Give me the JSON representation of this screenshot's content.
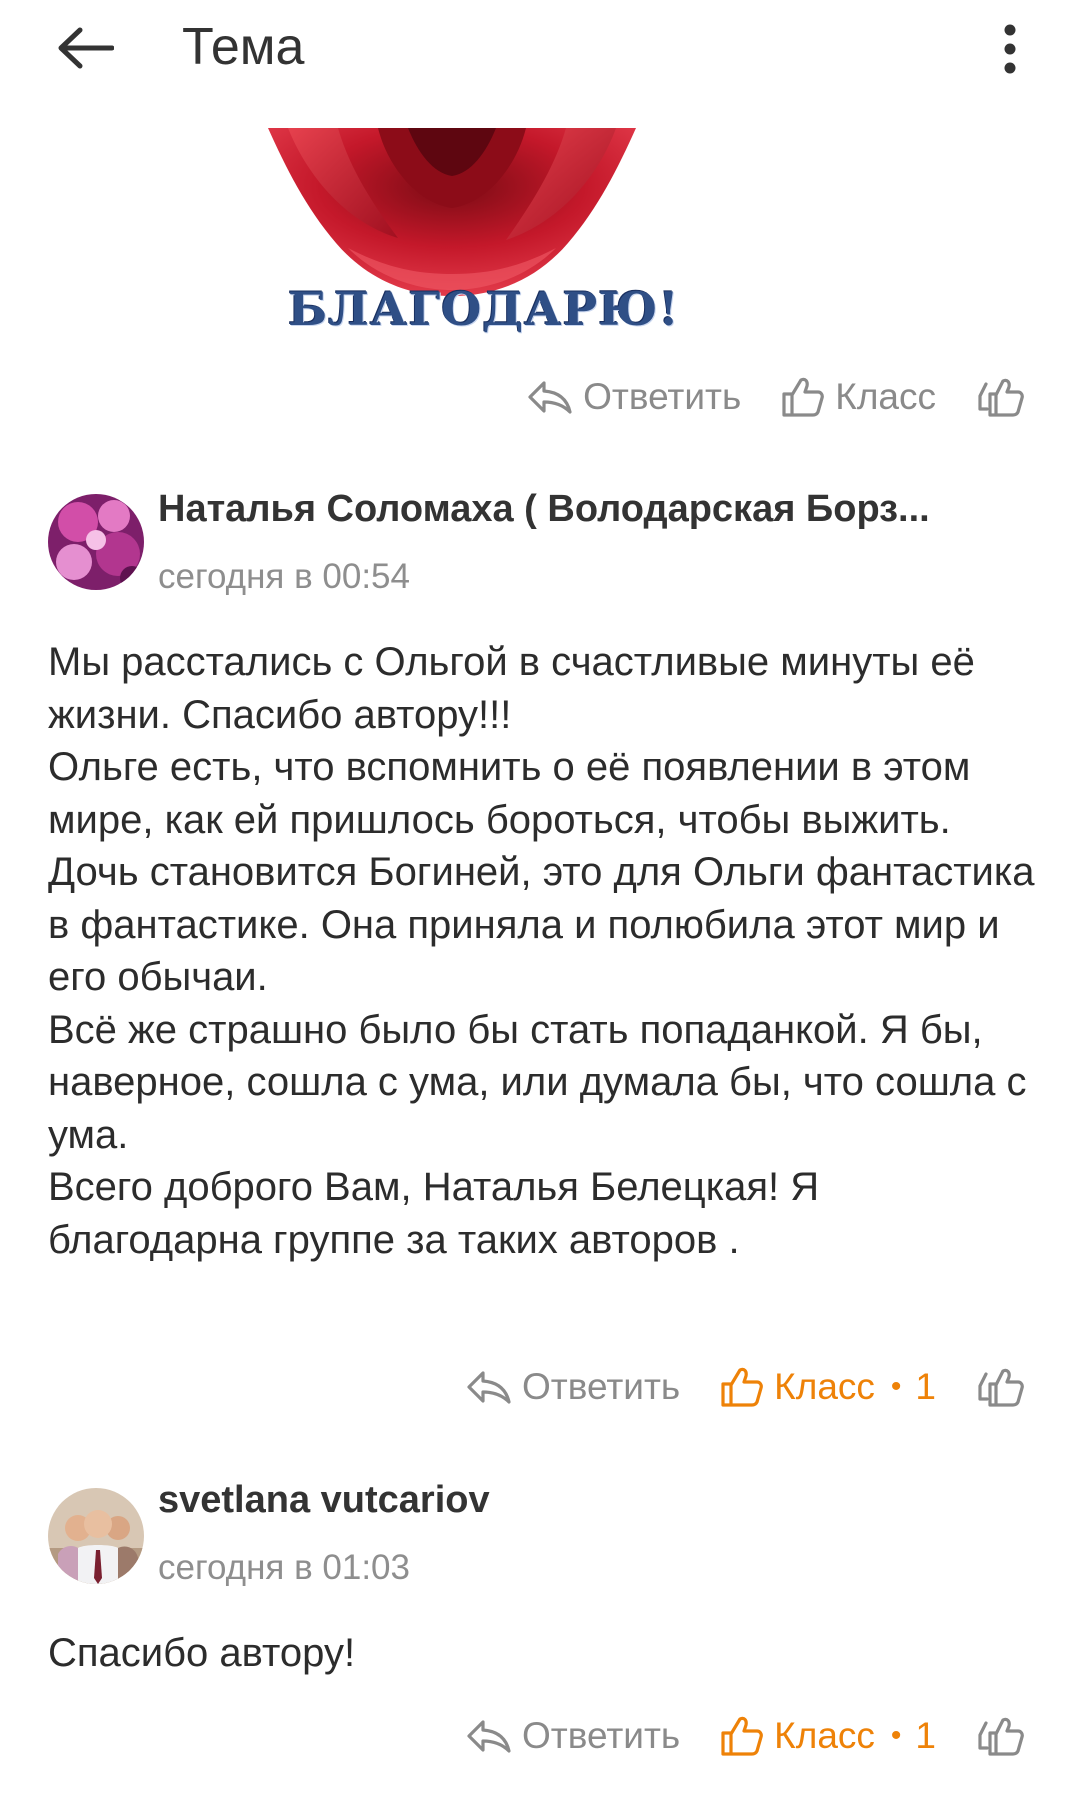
{
  "header": {
    "title": "Тема",
    "back_icon": "arrow-left-icon",
    "menu_icon": "more-vertical-icon"
  },
  "image_post": {
    "caption": "БЛАГОДАРЮ!",
    "actions": {
      "reply_label": "Ответить",
      "klass_label": "Класс"
    }
  },
  "comments": [
    {
      "author": "Наталья Соломаха ( Володарская Борз...",
      "time": "сегодня в 00:54",
      "text": "Мы расстались с Ольгой в счастливые минуты её жизни. Спасибо автору!!!\nОльге есть, что вспомнить о её появлении в этом мире, как ей пришлось бороться, чтобы выжить.\nДочь становится Богиней, это для Ольги фантастика в фантастике. Она приняла и полюбила этот мир и его обычаи.\nВсё же страшно было бы стать попаданкой. Я бы, наверное, сошла с ума, или думала бы, что сошла с ума.\nВсего доброго Вам, Наталья Белецкая! Я благодарна группе за таких авторов .",
      "reply_label": "Ответить",
      "klass_label": "Класс",
      "dot": "•",
      "klass_count": "1"
    },
    {
      "author": "svetlana vutcariov",
      "time": "сегодня в 01:03",
      "text": "Спасибо автору!",
      "reply_label": "Ответить",
      "klass_label": "Класс",
      "dot": "•",
      "klass_count": "1"
    }
  ],
  "colors": {
    "accent_orange": "#ee8208",
    "muted_gray": "#8a8a8a",
    "text": "#2c2c2c"
  }
}
